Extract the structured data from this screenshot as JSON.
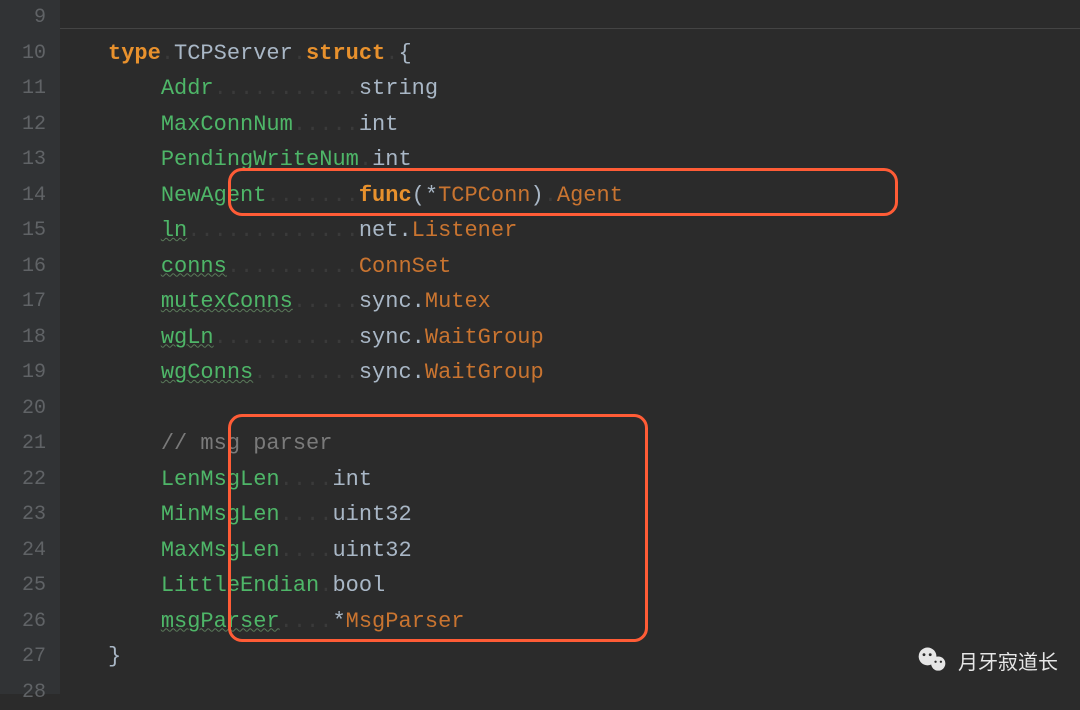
{
  "line_numbers": [
    "9",
    "10",
    "11",
    "12",
    "13",
    "14",
    "15",
    "16",
    "17",
    "18",
    "19",
    "20",
    "21",
    "22",
    "23",
    "24",
    "25",
    "26",
    "27",
    "28"
  ],
  "code": {
    "l10": {
      "kw1": "type",
      "name": "TCPServer",
      "kw2": "struct",
      "brace": "{"
    },
    "l11": {
      "field": "Addr",
      "type": "string"
    },
    "l12": {
      "field": "MaxConnNum",
      "type": "int"
    },
    "l13": {
      "field": "PendingWriteNum",
      "type": "int"
    },
    "l14": {
      "field": "NewAgent",
      "func": "func",
      "ptr": "*",
      "ptrtype": "TCPConn",
      "ret": "Agent"
    },
    "l15": {
      "field": "ln",
      "pkg": "net.",
      "type": "Listener"
    },
    "l16": {
      "field": "conns",
      "type": "ConnSet"
    },
    "l17": {
      "field": "mutexConns",
      "pkg": "sync.",
      "type": "Mutex"
    },
    "l18": {
      "field": "wgLn",
      "pkg": "sync.",
      "type": "WaitGroup"
    },
    "l19": {
      "field": "wgConns",
      "pkg": "sync.",
      "type": "WaitGroup"
    },
    "l21": {
      "comment": "// msg parser"
    },
    "l22": {
      "field": "LenMsgLen",
      "type": "int"
    },
    "l23": {
      "field": "MinMsgLen",
      "type": "uint32"
    },
    "l24": {
      "field": "MaxMsgLen",
      "type": "uint32"
    },
    "l25": {
      "field": "LittleEndian",
      "type": "bool"
    },
    "l26": {
      "field": "msgParser",
      "ptr": "*",
      "type": "MsgParser"
    },
    "l27": {
      "brace": "}"
    }
  },
  "watermark": {
    "text": "月牙寂道长"
  }
}
